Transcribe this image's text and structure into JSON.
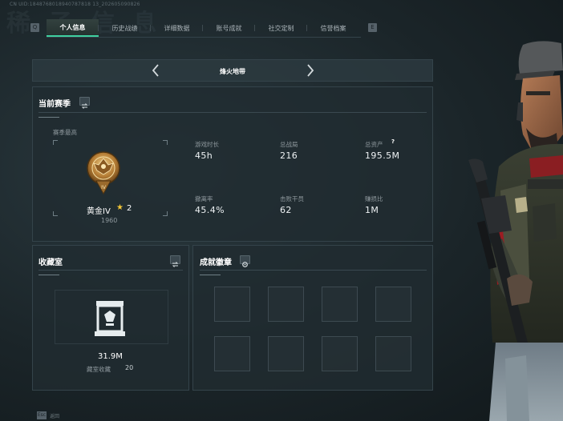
{
  "header": {
    "uid_text": "CN UID:1848768018940787818 13_202605090826",
    "ghost_text": "稀 子 信 息"
  },
  "tabs": [
    {
      "label": "个人信息",
      "active": true
    },
    {
      "label": "历史战绩",
      "active": false
    },
    {
      "label": "详细数据",
      "active": false
    },
    {
      "label": "账号成就",
      "active": false
    },
    {
      "label": "社交定制",
      "active": false
    },
    {
      "label": "信誉档案",
      "active": false
    }
  ],
  "tab_nav": {
    "left_key": "Q",
    "right_key": "E"
  },
  "map_selector": {
    "name": "烽火地带",
    "prev_icon": "chevron-left-icon",
    "next_icon": "chevron-right-icon"
  },
  "season": {
    "title": "当前赛季",
    "best_label": "赛季最高",
    "rank_name": "黄金IV",
    "rank_star_count": "2",
    "rank_score": "1960",
    "stats": [
      {
        "label": "游戏时长",
        "value": "45h"
      },
      {
        "label": "总战局",
        "value": "216"
      },
      {
        "label": "总资产",
        "value": "195.5M",
        "help": "?"
      },
      {
        "label": "撤离率",
        "value": "45.4%"
      },
      {
        "label": "击败干员",
        "value": "62"
      },
      {
        "label": "赚损比",
        "value": "1M"
      }
    ]
  },
  "collection": {
    "title": "收藏室",
    "value": "31.9M",
    "count_label": "藏室收藏",
    "count": "20"
  },
  "achievements": {
    "title": "成就徽章"
  },
  "footer": {
    "key": "Esc",
    "label": "返回"
  },
  "colors": {
    "accent": "#3fd0a0",
    "gold_star": "#f3c637",
    "panel_bg": "#212c31"
  }
}
